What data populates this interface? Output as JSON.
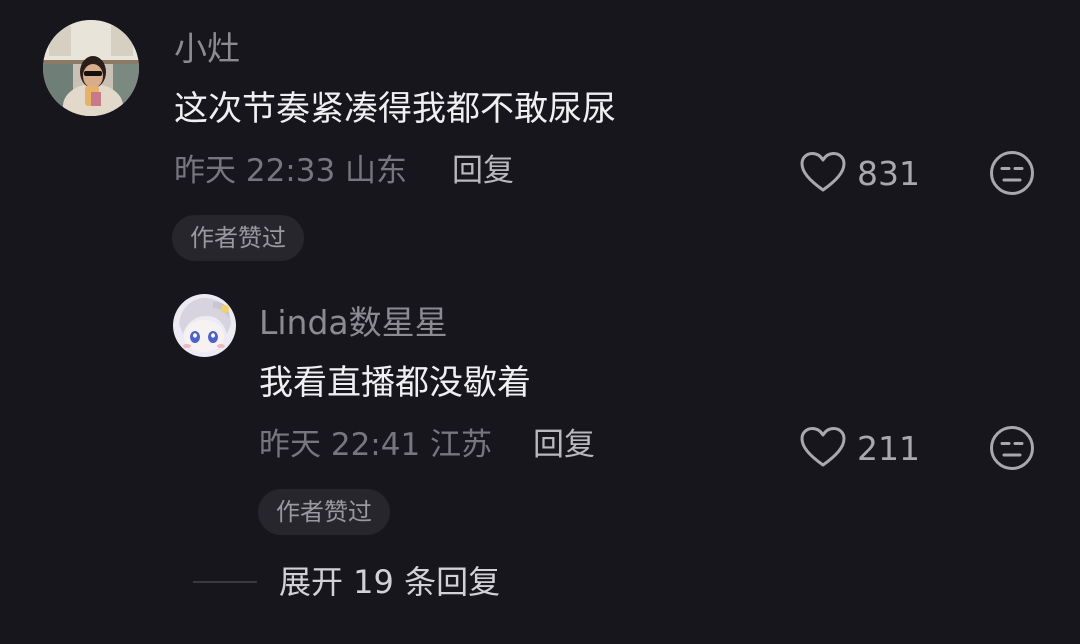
{
  "comments": [
    {
      "username": "小灶",
      "text": "这次节奏紧凑得我都不敢尿尿",
      "meta": "昨天 22:33 山东",
      "reply_label": "回复",
      "likes": "831",
      "badge": "作者赞过"
    }
  ],
  "replies": [
    {
      "username": "Linda数星星",
      "text": "我看直播都没歇着",
      "meta": "昨天 22:41 江苏",
      "reply_label": "回复",
      "likes": "211",
      "badge": "作者赞过"
    }
  ],
  "expand": {
    "label": "展开 19 条回复"
  },
  "icons": {
    "like": "heart-outline-icon",
    "dislike": "unamused-face-icon"
  },
  "colors": {
    "background": "#17161d",
    "badge_bg": "#27262d"
  }
}
